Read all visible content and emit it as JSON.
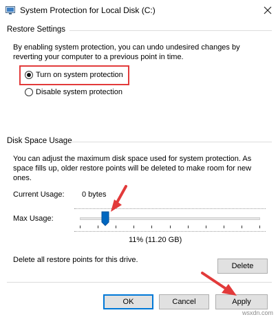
{
  "window": {
    "title": "System Protection for Local Disk (C:)"
  },
  "restore_settings": {
    "label": "Restore Settings",
    "description": "By enabling system protection, you can undo undesired changes by reverting your computer to a previous point in time.",
    "options": [
      {
        "label": "Turn on system protection",
        "selected": true
      },
      {
        "label": "Disable system protection",
        "selected": false
      }
    ]
  },
  "disk_space": {
    "label": "Disk Space Usage",
    "description": "You can adjust the maximum disk space used for system protection. As space fills up, older restore points will be deleted to make room for new ones.",
    "current_usage_label": "Current Usage:",
    "current_usage_value": "0 bytes",
    "max_usage_label": "Max Usage:",
    "max_usage_fraction": 0.11,
    "max_usage_readout": "11% (11.20 GB)"
  },
  "delete_section": {
    "text": "Delete all restore points for this drive.",
    "button_label": "Delete"
  },
  "buttons": {
    "ok": "OK",
    "cancel": "Cancel",
    "apply": "Apply"
  },
  "watermark": "wsxdn.com",
  "colors": {
    "annotation_red": "#e23a3a",
    "slider_thumb": "#0067c0",
    "default_button_border": "#0078d7"
  }
}
